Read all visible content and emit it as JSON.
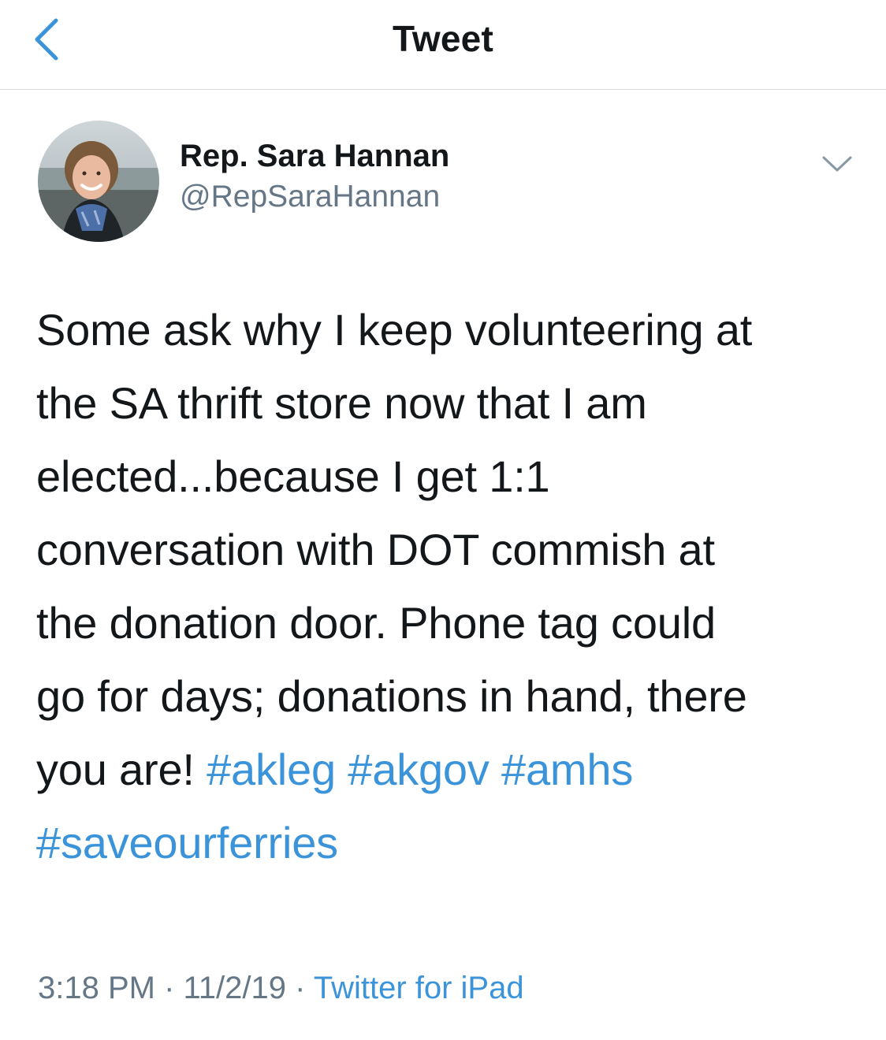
{
  "nav": {
    "title": "Tweet"
  },
  "author": {
    "name": "Rep. Sara Hannan",
    "handle": "@RepSaraHannan"
  },
  "tweet": {
    "lines": [
      "Some ask why I keep volunteering at",
      "the SA thrift store now that I am",
      "elected...because I get 1:1",
      "conversation with DOT commish at",
      "the donation door. Phone tag could",
      "go for days; donations in hand, there"
    ],
    "line7_text": "you are! ",
    "hashtags": [
      "#akleg",
      "#akgov",
      "#amhs",
      "#saveourferries"
    ]
  },
  "meta": {
    "time": "3:18 PM",
    "separator": " · ",
    "date": "11/2/19",
    "source": "Twitter for iPad"
  },
  "colors": {
    "link": "#3b94d9",
    "secondary_text": "#657786",
    "primary_text": "#14171a",
    "divider": "#d6d9dc"
  },
  "icons": {
    "back": "chevron-left-icon",
    "more": "chevron-down-icon"
  }
}
